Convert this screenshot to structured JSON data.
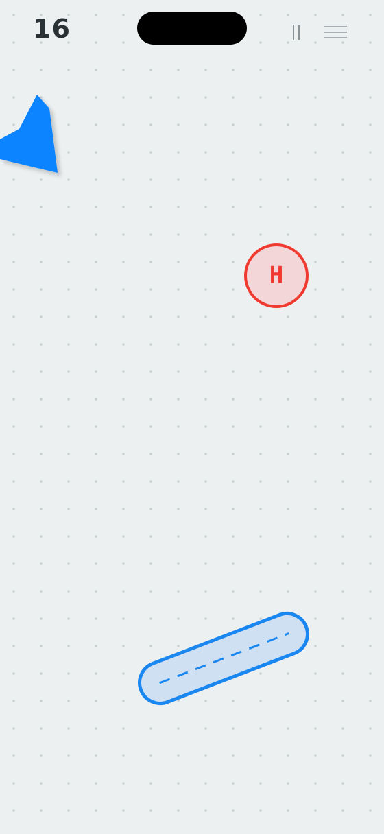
{
  "hud": {
    "score": "16",
    "pause_icon": "pause-icon",
    "menu_icon": "hamburger-menu-icon"
  },
  "game": {
    "target": {
      "label": "H",
      "stroke_color": "#f03a30",
      "fill_color": "#f3d7d8"
    },
    "player_shape_color": "#0a84ff",
    "paddle": {
      "stroke_color": "#1a86f0",
      "fill_color": "#cfe0f3"
    }
  },
  "colors": {
    "background": "#ecf0f1",
    "grid_dot": "#c9cfd3",
    "score_text": "#2b3236"
  }
}
